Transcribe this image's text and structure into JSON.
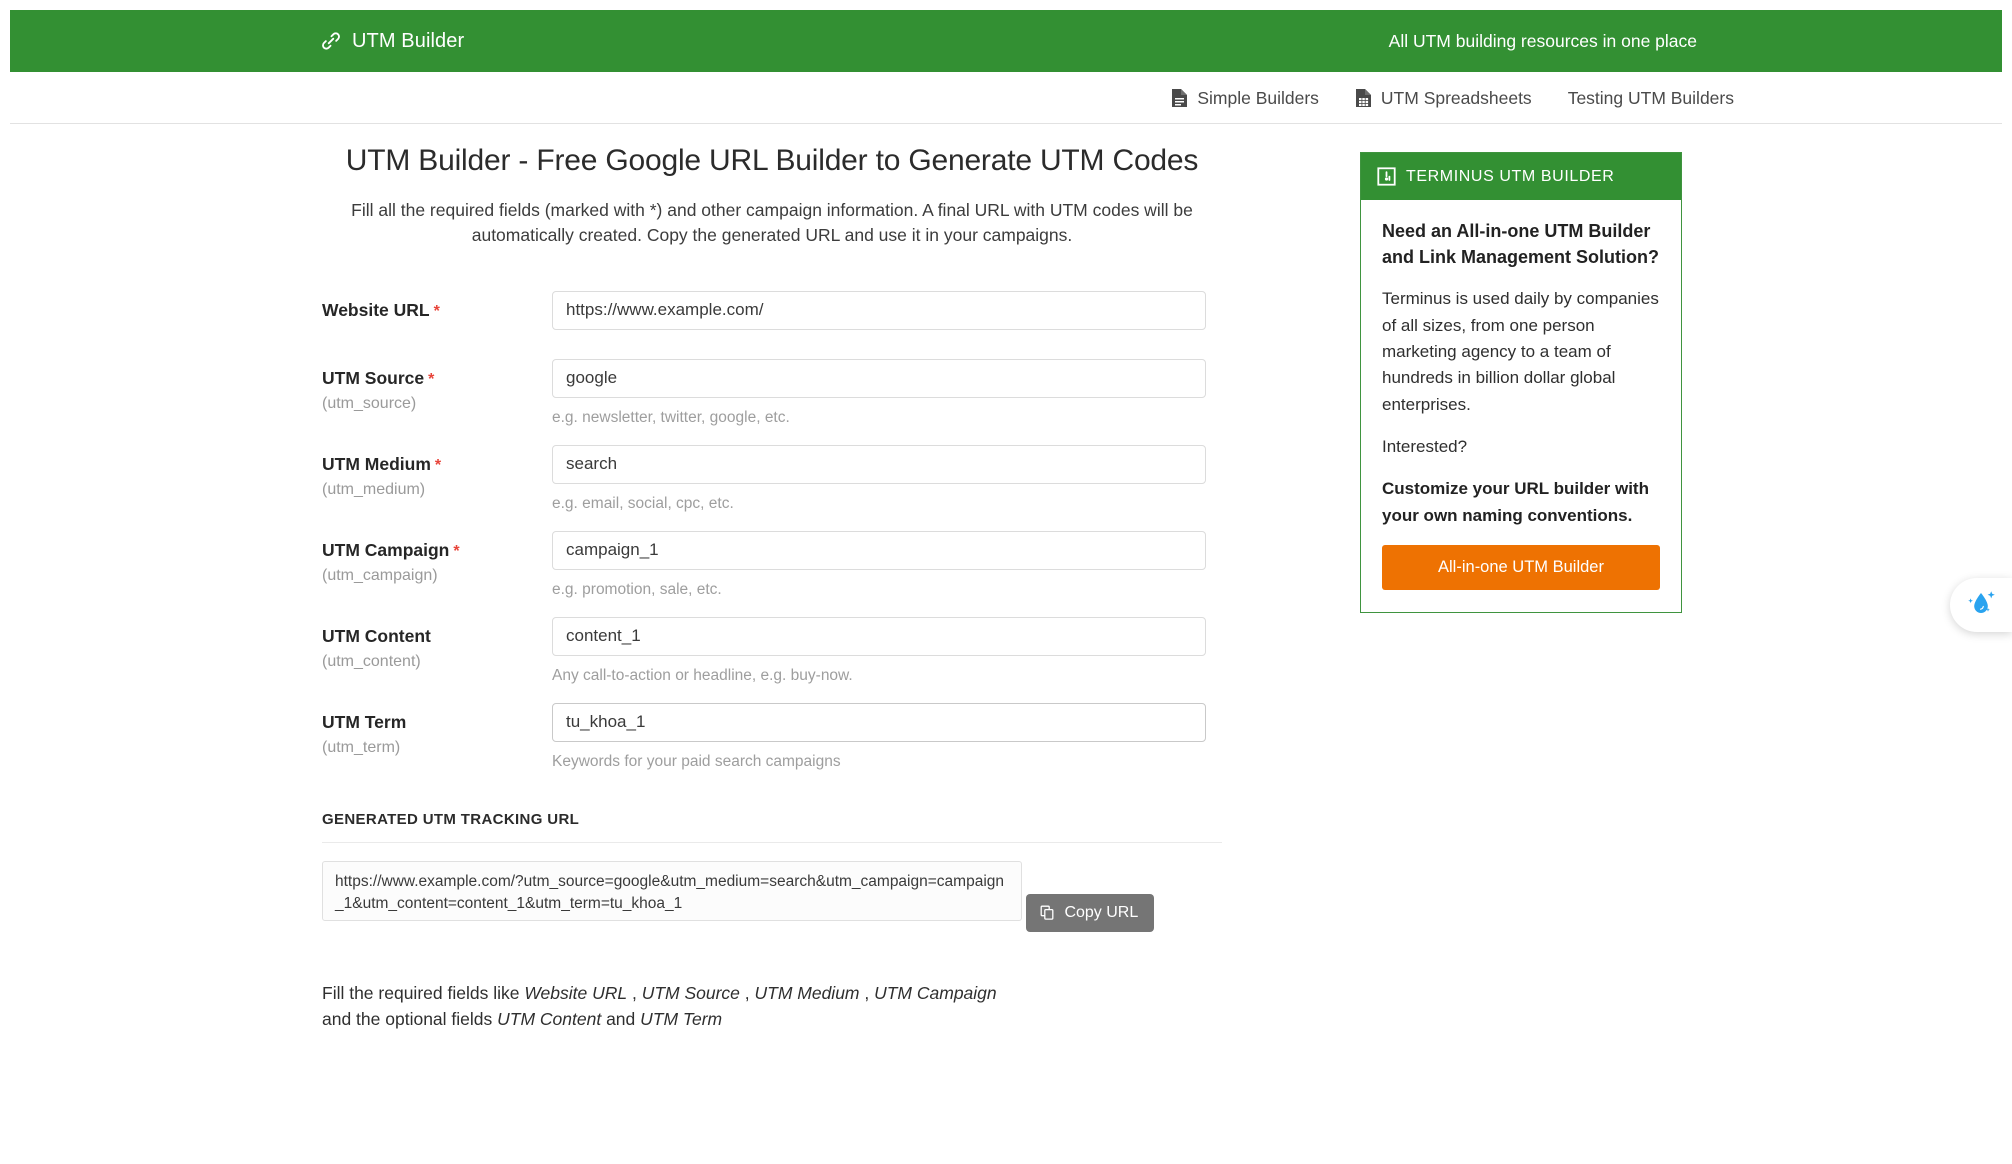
{
  "header": {
    "brand": "UTM Builder",
    "brand_icon": "link-icon",
    "tagline": "All UTM building resources in one place",
    "green": "#339033"
  },
  "nav": {
    "items": [
      {
        "label": "Simple Builders",
        "icon": "document-icon"
      },
      {
        "label": "UTM Spreadsheets",
        "icon": "spreadsheet-icon"
      },
      {
        "label": "Testing UTM Builders",
        "icon": ""
      }
    ]
  },
  "main": {
    "title": "UTM Builder - Free Google URL Builder to Generate UTM Codes",
    "subtitle": "Fill all the required fields (marked with *) and other campaign information. A final URL with UTM codes will be automatically created. Copy the generated URL and use it in your campaigns.",
    "required_mark": "*",
    "fields": [
      {
        "label": "Website URL",
        "sublabel": "",
        "required": true,
        "value": "https://www.example.com/",
        "placeholder": "https://www.example.com/",
        "hint": ""
      },
      {
        "label": "UTM Source",
        "sublabel": "(utm_source)",
        "required": true,
        "value": "google",
        "placeholder": "",
        "hint": "e.g. newsletter, twitter, google, etc."
      },
      {
        "label": "UTM Medium",
        "sublabel": "(utm_medium)",
        "required": true,
        "value": "search",
        "placeholder": "",
        "hint": "e.g. email, social, cpc, etc."
      },
      {
        "label": "UTM Campaign",
        "sublabel": "(utm_campaign)",
        "required": true,
        "value": "campaign_1",
        "placeholder": "",
        "hint": "e.g. promotion, sale, etc."
      },
      {
        "label": "UTM Content",
        "sublabel": "(utm_content)",
        "required": false,
        "value": "content_1",
        "placeholder": "",
        "hint": "Any call-to-action or headline, e.g. buy-now."
      },
      {
        "label": "UTM Term",
        "sublabel": "(utm_term)",
        "required": false,
        "value": "tu_khoa_1",
        "placeholder": "",
        "hint": "Keywords for your paid search campaigns"
      }
    ],
    "generated": {
      "heading": "GENERATED UTM TRACKING URL",
      "url": "https://www.example.com/?utm_source=google&utm_medium=search&utm_campaign=campaign_1&utm_content=content_1&utm_term=tu_khoa_1",
      "copy_label": "Copy URL",
      "copy_icon": "copy-icon"
    },
    "footnote_parts": {
      "a": "Fill the required fields like ",
      "b": "Website URL",
      "c": " , ",
      "d": "UTM Source",
      "e": " , ",
      "f": "UTM Medium",
      "g": " , ",
      "h": "UTM Campaign",
      "i": " and the optional fields ",
      "j": "UTM Content",
      "k": " and ",
      "l": "UTM Term"
    }
  },
  "sidebar": {
    "card": {
      "head_icon": "framed-link-icon",
      "head_title": "TERMINUS UTM BUILDER",
      "heading": "Need an All-in-one UTM Builder and Link Management Solution?",
      "paragraph1": "Terminus is used daily by companies of all sizes, from one person marketing agency to a team of hundreds in billion dollar global enterprises.",
      "paragraph2": "Interested?",
      "paragraph3": "Customize your URL builder with your own naming conventions.",
      "cta_label": "All-in-one UTM Builder",
      "cta_color": "#ee7202",
      "border_color": "#3f943f"
    }
  },
  "floating_widget": {
    "icon": "water-drop-sparkle-icon",
    "color": "#29a3ef"
  }
}
